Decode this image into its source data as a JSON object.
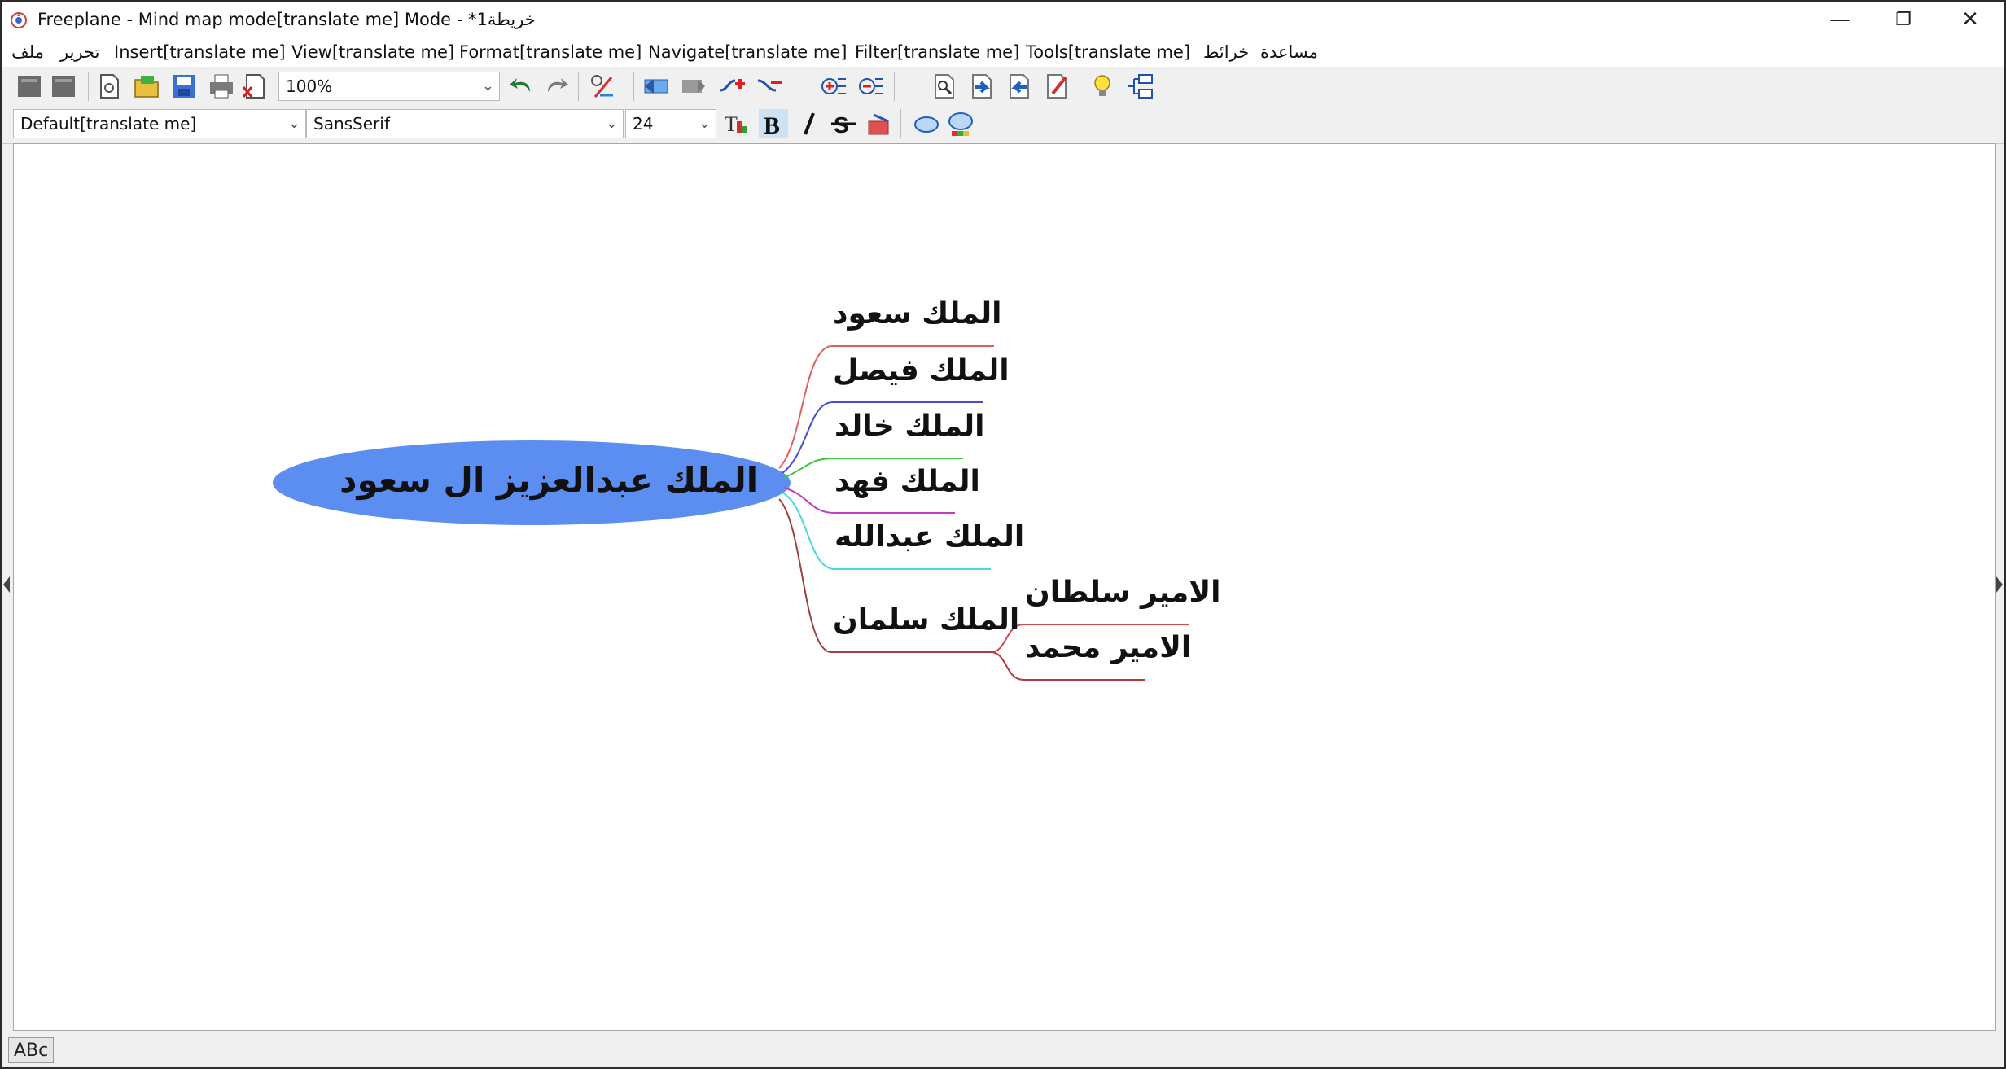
{
  "window": {
    "title": "Freeplane - Mind map mode[translate me] Mode - *1خريطة",
    "minimize": "—",
    "restore": "❐",
    "close": "✕"
  },
  "menu": {
    "items": [
      "ملف",
      "تحرير",
      "Insert[translate me]",
      "View[translate me]",
      "Format[translate me]",
      "Navigate[translate me]",
      "Filter[translate me]",
      "Tools[translate me]",
      "خرائط",
      "مساعدة"
    ]
  },
  "toolbar": {
    "zoom": "100%",
    "style": "Default[translate me]",
    "font": "SansSerif",
    "size": "24"
  },
  "mindmap": {
    "root": {
      "label": "الملك عبدالعزيز ال سعود",
      "color": "#5b8ef0"
    },
    "children": [
      {
        "label": "الملك سعود",
        "color": "#e06060"
      },
      {
        "label": "الملك فيصل",
        "color": "#4b4bd8"
      },
      {
        "label": "الملك خالد",
        "color": "#3ec43e"
      },
      {
        "label": "الملك فهد",
        "color": "#c23cc2"
      },
      {
        "label": "الملك عبدالله",
        "color": "#48d8e0"
      },
      {
        "label": "الملك سلمان",
        "color": "#a04040"
      }
    ],
    "grandchildren": [
      {
        "label": "الامير سلطان",
        "color": "#d84848"
      },
      {
        "label": "الامير محمد",
        "color": "#b83838"
      }
    ]
  },
  "status": {
    "input_mode": "ABc"
  }
}
